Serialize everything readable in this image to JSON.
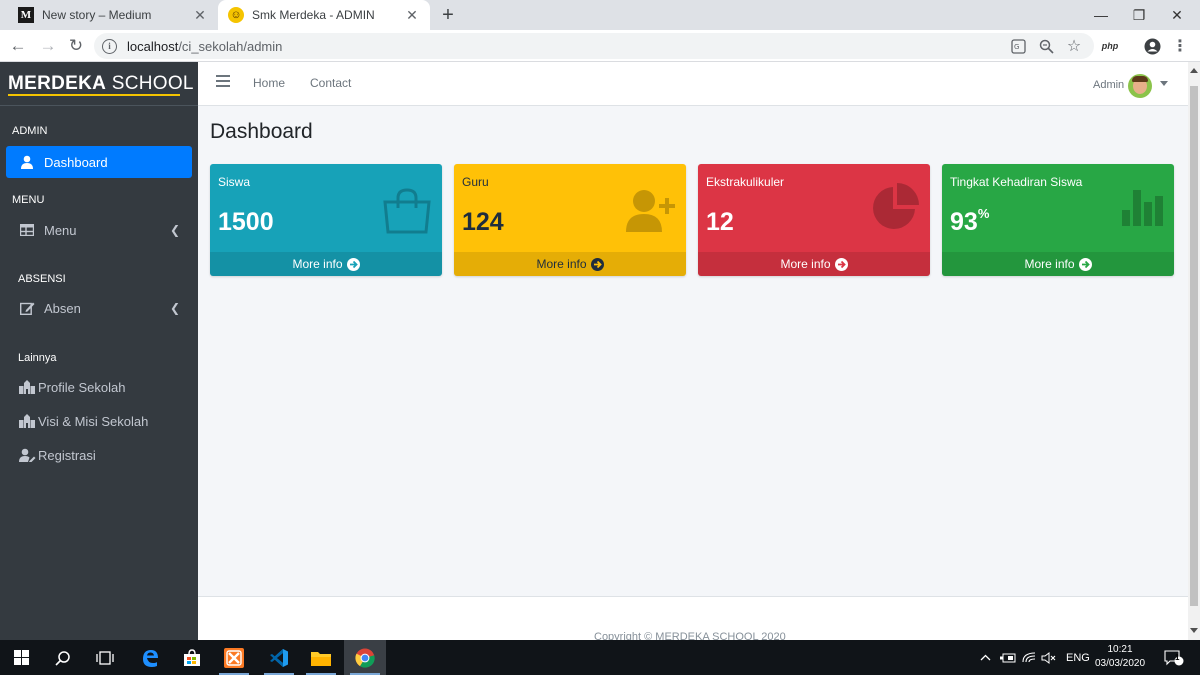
{
  "browser": {
    "tabs": [
      {
        "favicon": "M",
        "title": "New story – Medium"
      },
      {
        "favicon": "☺",
        "title": "Smk Merdeka - ADMIN"
      }
    ],
    "url_host": "localhost",
    "url_path": "/ci_sekolah/admin",
    "toolbar_php": "php"
  },
  "sidebar": {
    "brand_bold": "MERDEKA",
    "brand_rest": " SCHOOL",
    "sections": {
      "admin": "ADMIN",
      "menu": "MENU",
      "absensi": "ABSENSI",
      "lainnya": "Lainnya"
    },
    "items": {
      "dashboard": "Dashboard",
      "menu": "Menu",
      "absen": "Absen",
      "profile": "Profile Sekolah",
      "visi": "Visi & Misi Sekolah",
      "registrasi": "Registrasi"
    }
  },
  "topnav": {
    "home": "Home",
    "contact": "Contact",
    "user": "Admin"
  },
  "main": {
    "title": "Dashboard",
    "more_info": "More info",
    "boxes": [
      {
        "label": "Siswa",
        "value": "1500",
        "suffix": "",
        "color": "#17a2b8",
        "icon": "shopping-bag-icon"
      },
      {
        "label": "Guru",
        "value": "124",
        "suffix": "",
        "color": "#ffc107",
        "icon": "user-plus-icon"
      },
      {
        "label": "Ekstrakulikuler",
        "value": "12",
        "suffix": "",
        "color": "#dc3545",
        "icon": "pie-chart-icon"
      },
      {
        "label": "Tingkat Kehadiran Siswa",
        "value": "93",
        "suffix": "%",
        "color": "#28a745",
        "icon": "bar-chart-icon"
      }
    ]
  },
  "footer": {
    "copyright": "Copyright © MERDEKA SCHOOL 2020"
  },
  "taskbar": {
    "lang": "ENG",
    "time": "10:21",
    "date": "03/03/2020",
    "notifications": "1"
  }
}
